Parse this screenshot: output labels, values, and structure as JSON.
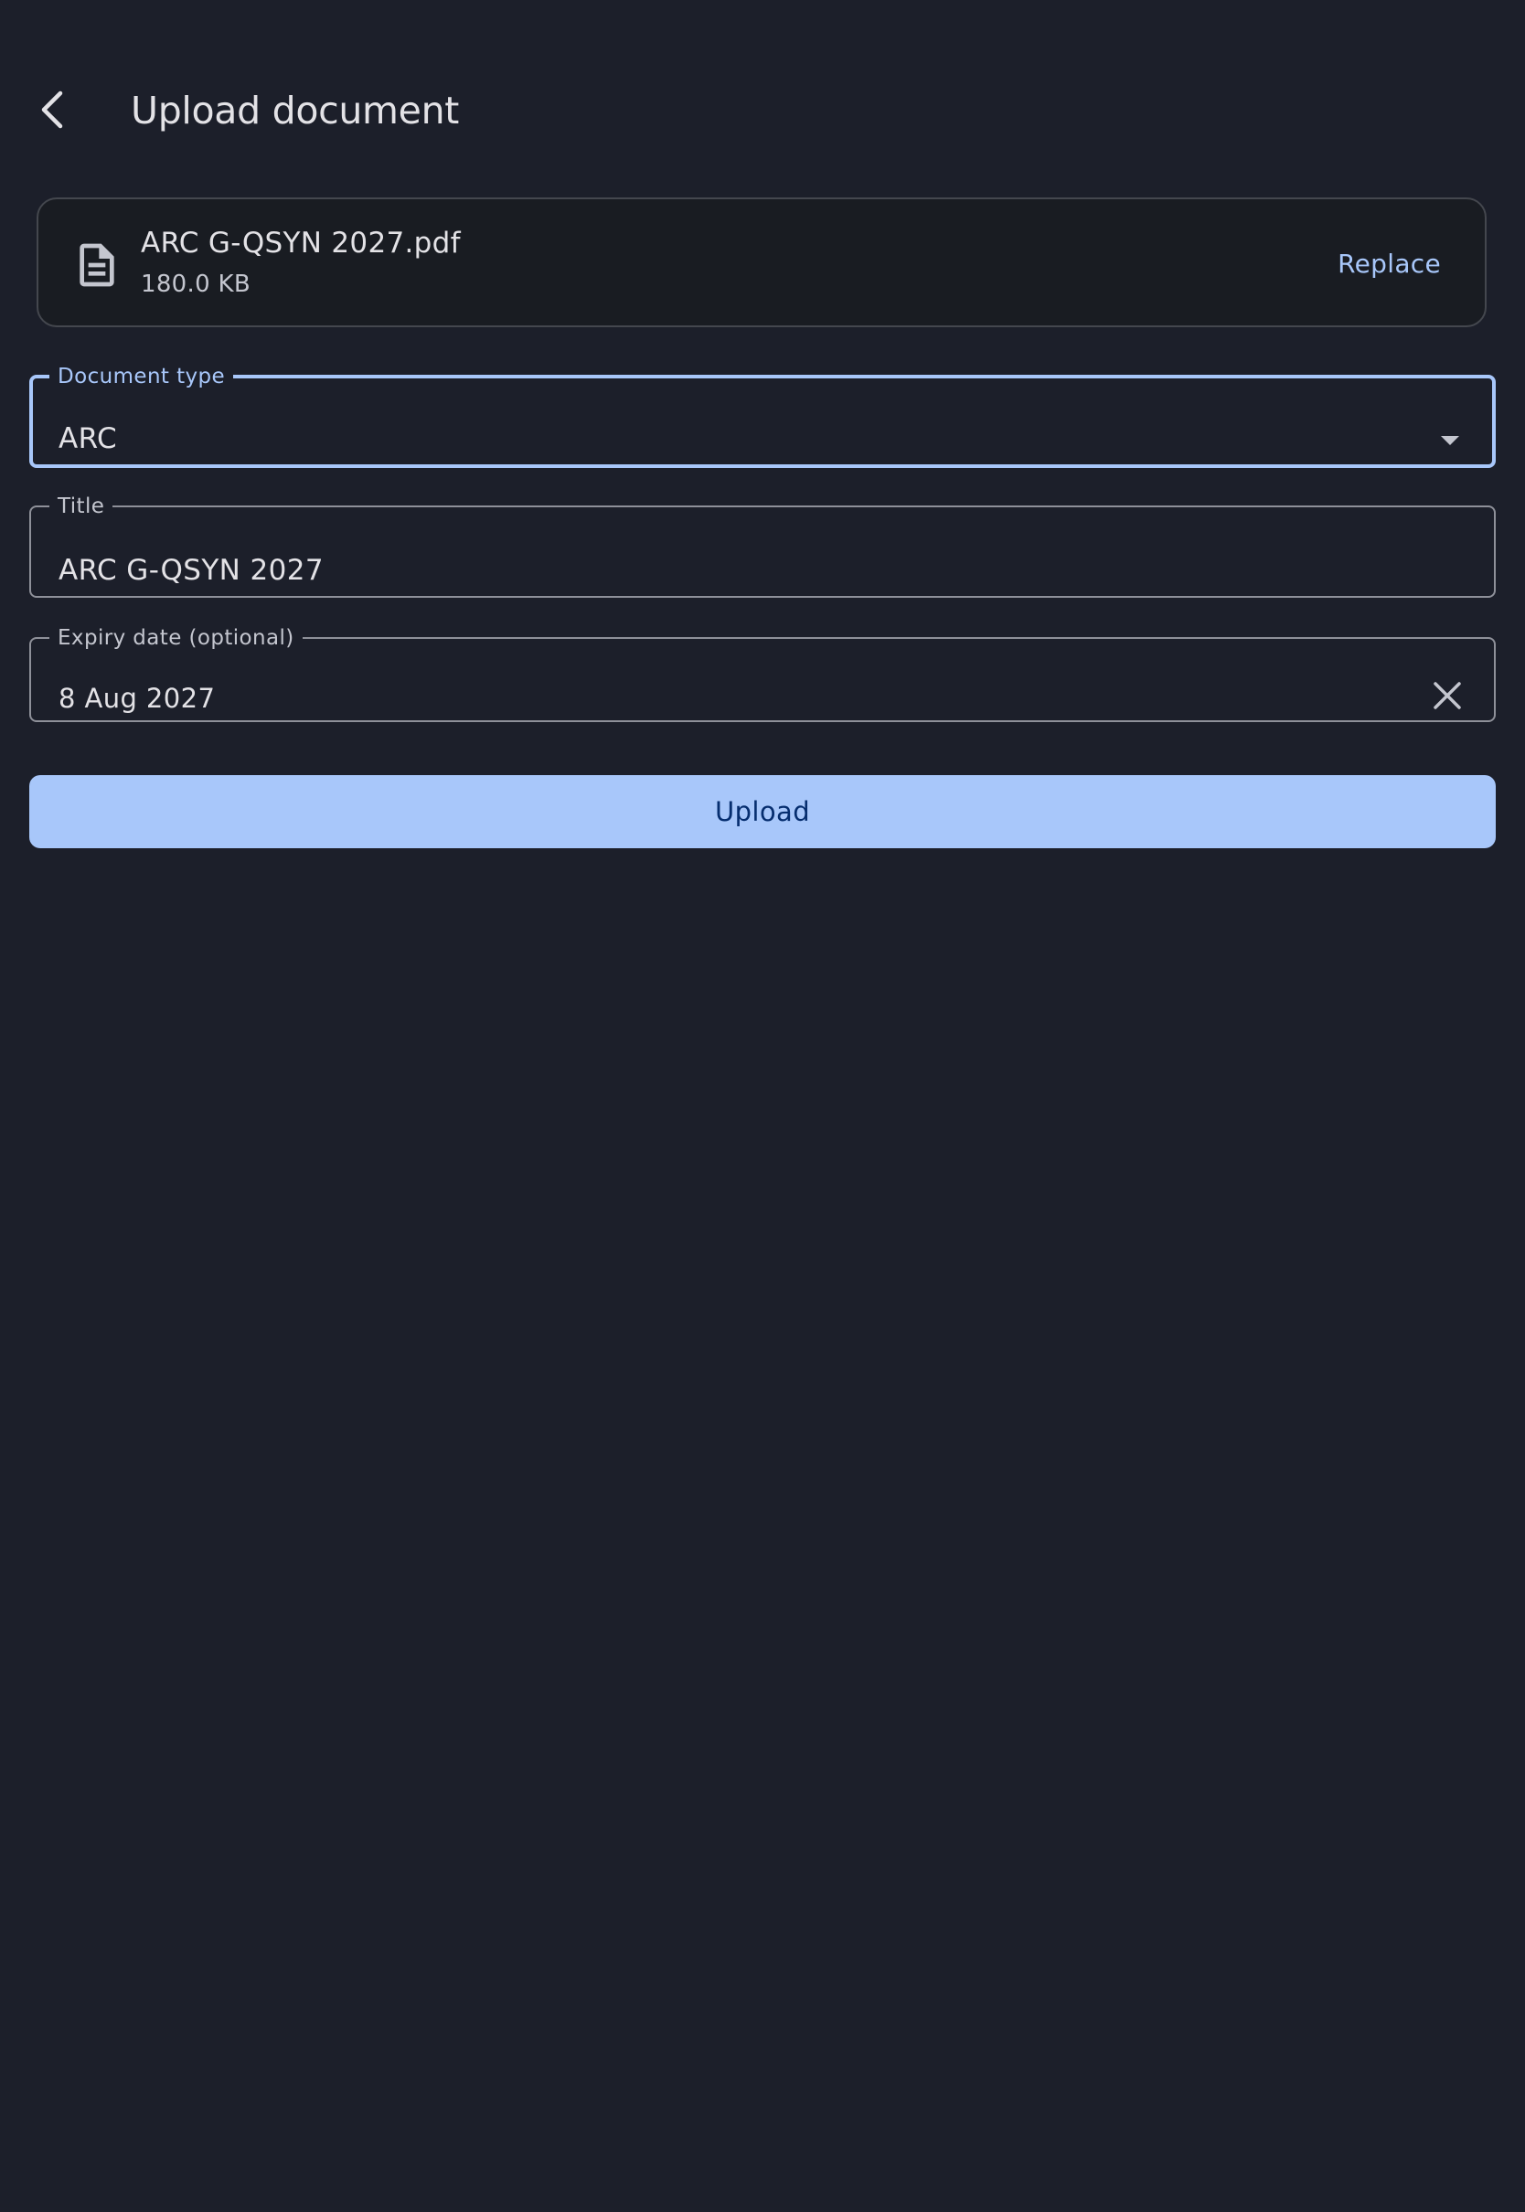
{
  "header": {
    "title": "Upload document"
  },
  "file": {
    "name": "ARC G-QSYN 2027.pdf",
    "size": "180.0 KB",
    "replace_label": "Replace"
  },
  "form": {
    "document_type": {
      "label": "Document type",
      "value": "ARC"
    },
    "title": {
      "label": "Title",
      "value": "ARC G-QSYN 2027"
    },
    "expiry": {
      "label": "Expiry date (optional)",
      "value": "8 Aug 2027"
    }
  },
  "actions": {
    "upload_label": "Upload"
  },
  "colors": {
    "background": "#1c1f2a",
    "accent": "#a8c7fa",
    "on_accent": "#062e6f",
    "outline": "#8e9099",
    "card_outline": "#44474e"
  },
  "icons": {
    "back": "arrow-back-icon",
    "file": "document-icon",
    "dropdown": "dropdown-arrow-icon",
    "clear": "close-icon"
  }
}
